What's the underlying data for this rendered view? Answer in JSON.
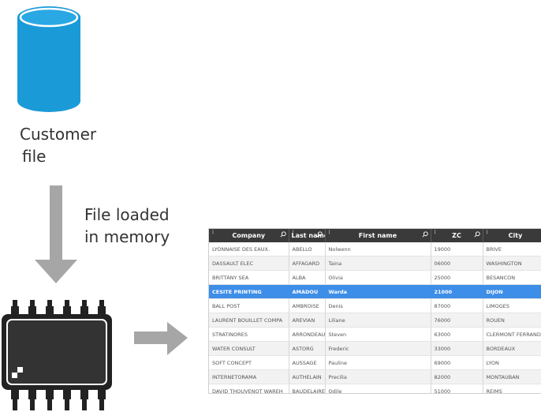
{
  "source": {
    "label_line1": "Customer",
    "label_line2": "file"
  },
  "flow": {
    "label_line1": "File loaded",
    "label_line2": "in memory"
  },
  "table": {
    "columns": [
      "Company",
      "Last name",
      "First name",
      "ZC",
      "City"
    ],
    "selected_row": 3,
    "rows": [
      [
        "LYONNAISE DES EAUX.",
        "ABELLO",
        "Nolwenn",
        "19000",
        "BRIVE"
      ],
      [
        "DASSAULT ELEC",
        "AFFAGARD",
        "Taina",
        "06000",
        "WASHINGTON"
      ],
      [
        "BRITTANY SEA",
        "ALBA",
        "Olivia",
        "25000",
        "BESANCON"
      ],
      [
        "CESITE PRINTING",
        "AMADOU",
        "Warda",
        "21000",
        "DIJON"
      ],
      [
        "BALL POST",
        "AMBROISE",
        "Denis",
        "87000",
        "LIMOGES"
      ],
      [
        "LAURENT BOUILLET COMPA",
        "AREVIAN",
        "Liliane",
        "76000",
        "ROUEN"
      ],
      [
        "STRATINORES",
        "ARRONDEAU",
        "Steven",
        "63000",
        "CLERMONT FERRAND"
      ],
      [
        "WATER CONSULT",
        "ASTORG",
        "Frederic",
        "33000",
        "BORDEAUX"
      ],
      [
        "SOFT CONCEPT",
        "AUSSAGE",
        "Pauline",
        "69000",
        "LYON"
      ],
      [
        "INTERNETORAMA",
        "AUTHELAIN",
        "Precilia",
        "82000",
        "MONTAUBAN"
      ],
      [
        "DAVID THOUVENOT WAREH",
        "BAUDELAIRE",
        "Odile",
        "51000",
        "REIMS"
      ]
    ]
  },
  "colors": {
    "database": "#1b9ad8",
    "database_top": "#2aa8e4",
    "arrow": "#a6a6a6",
    "chip": "#222222",
    "header": "#3a3a3a",
    "selected": "#3d8ee8"
  }
}
